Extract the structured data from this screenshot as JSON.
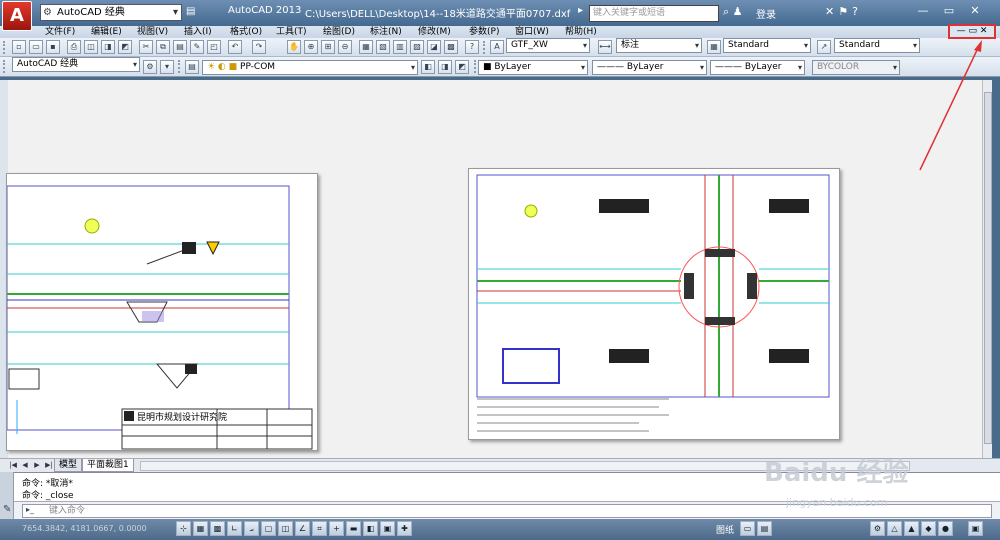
{
  "titlebar": {
    "logo": "A",
    "workspace": "AutoCAD 经典",
    "app_name": "AutoCAD 2013",
    "file_path": "C:\\Users\\DELL\\Desktop\\14--18米道路交通平面0707.dxf",
    "search_placeholder": "键入关键字或短语",
    "login_label": "登录",
    "window_buttons": [
      "—",
      "▭",
      "✕"
    ]
  },
  "menu": {
    "items": [
      "文件(F)",
      "编辑(E)",
      "视图(V)",
      "插入(I)",
      "格式(O)",
      "工具(T)",
      "绘图(D)",
      "标注(N)",
      "修改(M)",
      "参数(P)",
      "窗口(W)",
      "帮助(H)"
    ],
    "mdi_controls": "— ▭ ✕"
  },
  "toolbar1": {
    "text_style": "GTF_XW",
    "dim_style": "标注",
    "table_style": "Standard",
    "mleader_style": "Standard"
  },
  "toolbar2": {
    "workspace": "AutoCAD 经典",
    "layer": "PP-COM",
    "color": "ByLayer",
    "linetype": "ByLayer",
    "lineweight": "ByLayer",
    "plotstyle": "BYCOLOR"
  },
  "layout_tabs": {
    "tabs": [
      "模型",
      "平面裁图1"
    ],
    "active": 1
  },
  "command": {
    "history": [
      "命令: *取消*",
      "命令: _close"
    ],
    "placeholder": "键入命令"
  },
  "statusbar": {
    "coords": "7654.3842, 4181.0667, 0.0000",
    "model_label": "图纸"
  },
  "drawing": {
    "left_sheet_title": "昆明市规划设计研究院"
  },
  "watermark": {
    "text": "Baidu 经验",
    "url": "jingyan.baidu.com"
  },
  "colors": {
    "annotation_red": "#e03030",
    "titlebar": "#44698f",
    "viewport": "#f1f1f1"
  }
}
